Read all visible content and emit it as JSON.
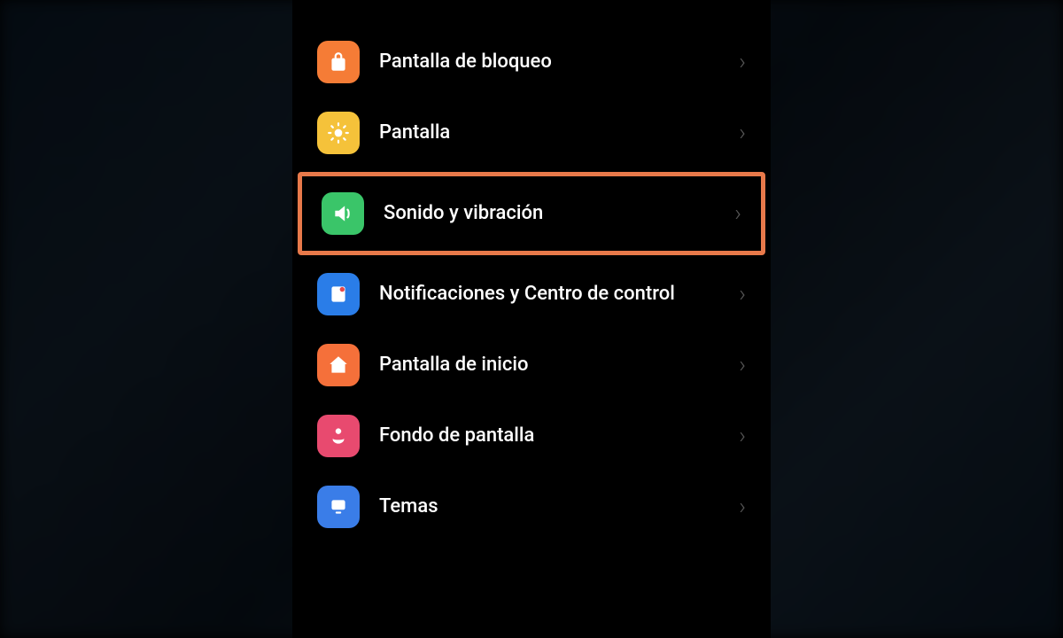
{
  "settings": {
    "items": [
      {
        "key": "lock-screen",
        "label": "Pantalla de bloqueo",
        "icon": "lock-icon",
        "color": "icon-lock",
        "highlighted": false
      },
      {
        "key": "display",
        "label": "Pantalla",
        "icon": "sun-icon",
        "color": "icon-display",
        "highlighted": false
      },
      {
        "key": "sound-vibration",
        "label": "Sonido y vibración",
        "icon": "speaker-icon",
        "color": "icon-sound",
        "highlighted": true
      },
      {
        "key": "notifications",
        "label": "Notificaciones y Centro de control",
        "icon": "notification-icon",
        "color": "icon-notif",
        "highlighted": false
      },
      {
        "key": "home-screen",
        "label": "Pantalla de inicio",
        "icon": "home-icon",
        "color": "icon-home",
        "highlighted": false
      },
      {
        "key": "wallpaper",
        "label": "Fondo de pantalla",
        "icon": "flower-icon",
        "color": "icon-wallpaper",
        "highlighted": false
      },
      {
        "key": "themes",
        "label": "Temas",
        "icon": "themes-icon",
        "color": "icon-themes",
        "highlighted": false
      }
    ]
  },
  "highlight_color": "#e8794a"
}
